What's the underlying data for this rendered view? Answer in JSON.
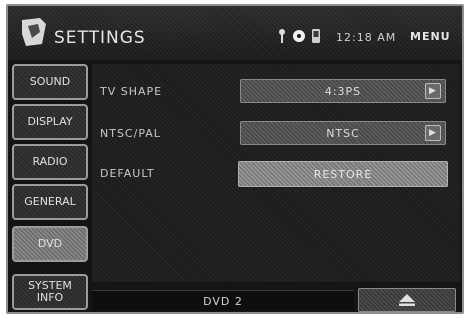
{
  "header": {
    "title": "SETTINGS",
    "clock": "12:18 AM",
    "menu_label": "MENU",
    "icons": [
      "settings-logo-icon",
      "antenna-icon",
      "disc-icon",
      "phone-icon"
    ]
  },
  "sidebar": {
    "items": [
      {
        "label": "SOUND",
        "active": false
      },
      {
        "label": "DISPLAY",
        "active": false
      },
      {
        "label": "RADIO",
        "active": false
      },
      {
        "label": "GENERAL",
        "active": false
      },
      {
        "label": "DVD",
        "active": true
      },
      {
        "label": "SYSTEM INFO",
        "line1": "SYSTEM",
        "line2": "INFO",
        "active": false
      }
    ]
  },
  "settings": {
    "tv_shape": {
      "label": "TV SHAPE",
      "value": "4:3PS"
    },
    "ntsc_pal": {
      "label": "NTSC/PAL",
      "value": "NTSC"
    },
    "default": {
      "label": "DEFAULT",
      "button": "RESTORE"
    }
  },
  "footer": {
    "source": "DVD 2",
    "eject_icon": "eject-icon"
  },
  "colors": {
    "background": "#141414",
    "frame_border": "#8f8f8f",
    "active_tab": "#6e6e6e",
    "text": "#e0e0e0"
  }
}
